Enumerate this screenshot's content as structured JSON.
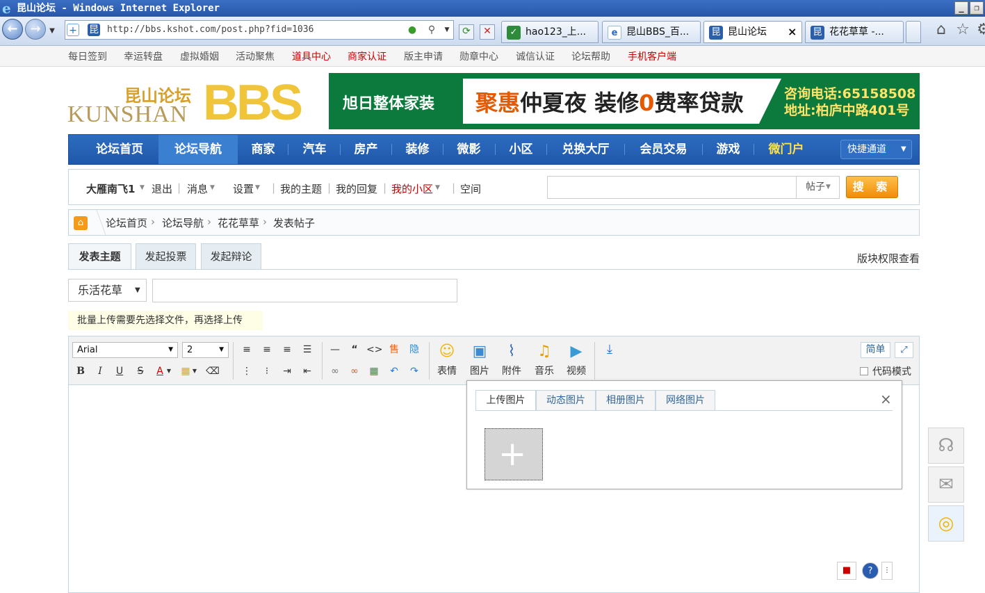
{
  "window": {
    "title": "昆山论坛 - Windows Internet Explorer",
    "minimize": "_",
    "restore": "❐"
  },
  "browser": {
    "url": "http://bbs.kshot.com/post.php?fid=1036",
    "tabs": [
      {
        "label": "hao123_上...",
        "icon": "hao123-icon"
      },
      {
        "label": "昆山BBS_百...",
        "icon": "ie-icon"
      },
      {
        "label": "昆山论坛",
        "icon": "kunshan-icon",
        "close": "×"
      },
      {
        "label": "花花草草 -...",
        "icon": "kunshan-icon"
      }
    ]
  },
  "toplinks": [
    "每日签到",
    "幸运转盘",
    "虚拟婚姻",
    "活动聚焦",
    "道具中心",
    "商家认证",
    "版主申请",
    "勋章中心",
    "诚信认证",
    "论坛帮助",
    "手机客户端"
  ],
  "logo": {
    "cn": "昆山论坛",
    "en": "KUNSHAN",
    "bbs": "BBS"
  },
  "banner": {
    "brand": "旭日整体家装",
    "slogan_hl": "聚惠",
    "slogan": "仲夏夜 装修",
    "slogan_zero": "0",
    "slogan_end": "费率贷款",
    "phone": "咨询电话:65158508",
    "address": "地址:柏庐中路401号"
  },
  "mainnav": {
    "items": [
      "论坛首页",
      "论坛导航",
      "商家",
      "汽车",
      "房产",
      "装修",
      "微影",
      "小区",
      "兑换大厅",
      "会员交易",
      "游戏",
      "微门户"
    ],
    "quick": "快捷通道"
  },
  "userbar": {
    "username": "大雁南飞1",
    "logout": "退出",
    "messages": "消息",
    "settings": "设置",
    "my_topics": "我的主题",
    "my_replies": "我的回复",
    "my_community": "我的小区",
    "space": "空间",
    "search_type": "帖子",
    "search_button": "搜 索"
  },
  "breadcrumb": [
    "论坛首页",
    "论坛导航",
    "花花草草",
    "发表帖子"
  ],
  "post_tabs": [
    "发表主题",
    "发起投票",
    "发起辩论"
  ],
  "permissions": "版块权限查看",
  "category": "乐活花草",
  "title_value": "",
  "tip": "批量上传需要先选择文件，再选择上传",
  "editor": {
    "font": "Arial",
    "size": "2",
    "buttons": [
      "表情",
      "图片",
      "附件",
      "音乐",
      "视频"
    ],
    "simple": "简单",
    "code_mode": "代码模式",
    "hide_label": "隐",
    "sell_label": "售"
  },
  "image_popup": {
    "tabs": [
      "上传图片",
      "动态图片",
      "相册图片",
      "网络图片"
    ],
    "close": "×",
    "add": "+"
  }
}
